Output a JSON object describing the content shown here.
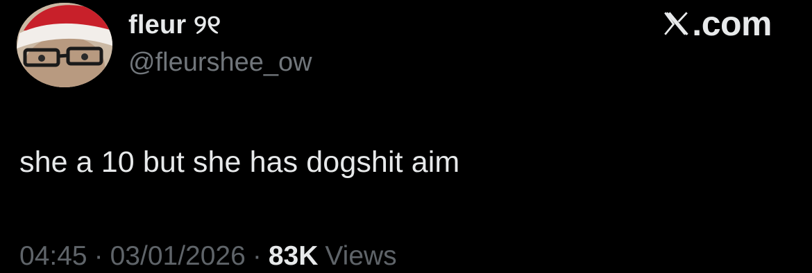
{
  "author": {
    "display_name": "fleur ୨୧",
    "handle": "@fleurshee_ow",
    "avatar_icon": "profile-avatar-santa-hat"
  },
  "brand": {
    "logo_icon": "x-logo-icon",
    "text": ".com"
  },
  "tweet": {
    "text": "she a 10 but she has dogshit aim"
  },
  "meta": {
    "time": "04:45",
    "date": "03/01/2026",
    "separator": "·",
    "views_count": "83K",
    "views_label": "Views"
  },
  "colors": {
    "background": "#000000",
    "primary_text": "#e7e9ea",
    "secondary_text": "#71767b"
  }
}
